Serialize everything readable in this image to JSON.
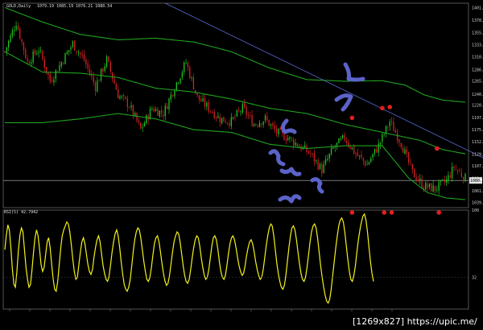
{
  "chart_data": [
    {
      "type": "candlestick",
      "symbol_label": "GOLD,Daily",
      "ohlc_label": "1079.19 1085.19 1076.21 1080.54",
      "yticks": [
        "1401.6",
        "1378.8",
        "1355.3",
        "1333.3",
        "1310.5",
        "1286.5",
        "1265.9",
        "1240.8",
        "1220.7",
        "1197.8",
        "1175.4",
        "1152.5",
        "1129.5",
        "1107.6",
        "1084.6",
        "1061.6",
        "1039.5"
      ],
      "ylim": [
        1030,
        1410
      ],
      "current_price": "1080.54",
      "bull_color": "#23c423",
      "bear_color": "#d42323",
      "bands_color": "#1fa31f",
      "trendline_color": "#5a6ad6",
      "marker_color": "#e01f1f",
      "series": [
        {
          "name": "price",
          "anchors": [
            [
              0,
              1320
            ],
            [
              6,
              1375
            ],
            [
              12,
              1300
            ],
            [
              18,
              1325
            ],
            [
              24,
              1265
            ],
            [
              30,
              1300
            ],
            [
              36,
              1335
            ],
            [
              42,
              1305
            ],
            [
              48,
              1255
            ],
            [
              54,
              1305
            ],
            [
              60,
              1240
            ],
            [
              66,
              1220
            ],
            [
              72,
              1175
            ],
            [
              78,
              1215
            ],
            [
              84,
              1205
            ],
            [
              90,
              1255
            ],
            [
              96,
              1300
            ],
            [
              102,
              1235
            ],
            [
              108,
              1215
            ],
            [
              114,
              1195
            ],
            [
              120,
              1190
            ],
            [
              126,
              1215
            ],
            [
              132,
              1185
            ],
            [
              138,
              1195
            ],
            [
              144,
              1170
            ],
            [
              150,
              1160
            ],
            [
              156,
              1145
            ],
            [
              162,
              1130
            ],
            [
              168,
              1100
            ],
            [
              174,
              1140
            ],
            [
              180,
              1160
            ],
            [
              186,
              1130
            ],
            [
              192,
              1110
            ],
            [
              198,
              1145
            ],
            [
              204,
              1190
            ],
            [
              210,
              1150
            ],
            [
              216,
              1095
            ],
            [
              222,
              1070
            ],
            [
              228,
              1065
            ],
            [
              234,
              1080
            ],
            [
              238,
              1105
            ],
            [
              244,
              1085
            ]
          ]
        },
        {
          "name": "upper_band",
          "anchors": [
            [
              0,
              1402
            ],
            [
              20,
              1375
            ],
            [
              40,
              1352
            ],
            [
              60,
              1342
            ],
            [
              80,
              1345
            ],
            [
              100,
              1338
            ],
            [
              120,
              1320
            ],
            [
              140,
              1290
            ],
            [
              160,
              1268
            ],
            [
              180,
              1265
            ],
            [
              200,
              1266
            ],
            [
              212,
              1258
            ],
            [
              222,
              1240
            ],
            [
              232,
              1230
            ],
            [
              244,
              1226
            ]
          ]
        },
        {
          "name": "middle_band",
          "anchors": [
            [
              0,
              1320
            ],
            [
              20,
              1282
            ],
            [
              40,
              1280
            ],
            [
              60,
              1272
            ],
            [
              80,
              1252
            ],
            [
              100,
              1245
            ],
            [
              120,
              1232
            ],
            [
              140,
              1215
            ],
            [
              160,
              1205
            ],
            [
              180,
              1185
            ],
            [
              200,
              1170
            ],
            [
              220,
              1155
            ],
            [
              232,
              1138
            ],
            [
              244,
              1130
            ]
          ]
        },
        {
          "name": "lower_band",
          "anchors": [
            [
              0,
              1188
            ],
            [
              20,
              1188
            ],
            [
              40,
              1195
            ],
            [
              60,
              1205
            ],
            [
              80,
              1195
            ],
            [
              100,
              1175
            ],
            [
              120,
              1170
            ],
            [
              140,
              1148
            ],
            [
              160,
              1140
            ],
            [
              180,
              1145
            ],
            [
              200,
              1145
            ],
            [
              214,
              1085
            ],
            [
              224,
              1058
            ],
            [
              234,
              1048
            ],
            [
              244,
              1045
            ]
          ]
        }
      ],
      "trendlines": [
        [
          [
            85,
            1410
          ],
          [
            302,
            1040
          ]
        ]
      ],
      "markers": [
        [
          200,
          1215
        ],
        [
          204,
          1217
        ],
        [
          184,
          1197
        ],
        [
          229,
          1140
        ],
        [
          184,
          1045
        ],
        [
          201,
          1042
        ],
        [
          205,
          1042
        ],
        [
          230,
          1040
        ]
      ],
      "bar_count": 245
    },
    {
      "type": "line",
      "label": "RSI(5) 42.7942",
      "color": "#f2f21a",
      "ylim": [
        0,
        100
      ],
      "yticks": [
        "100",
        "32"
      ],
      "values": [
        60,
        75,
        85,
        80,
        62,
        40,
        25,
        22,
        38,
        60,
        75,
        82,
        78,
        60,
        42,
        30,
        22,
        25,
        40,
        58,
        72,
        80,
        74,
        60,
        45,
        38,
        42,
        55,
        68,
        72,
        62,
        45,
        30,
        20,
        18,
        28,
        45,
        62,
        74,
        80,
        84,
        88,
        86,
        78,
        65,
        50,
        38,
        30,
        32,
        45,
        58,
        68,
        72,
        66,
        55,
        45,
        38,
        35,
        40,
        52,
        62,
        70,
        74,
        68,
        56,
        44,
        36,
        30,
        28,
        33,
        45,
        58,
        68,
        76,
        80,
        74,
        62,
        48,
        35,
        25,
        20,
        18,
        22,
        30,
        44,
        58,
        70,
        78,
        82,
        80,
        72,
        60,
        48,
        38,
        30,
        28,
        32,
        42,
        55,
        66,
        72,
        74,
        68,
        58,
        46,
        36,
        28,
        24,
        26,
        34,
        46,
        58,
        68,
        74,
        78,
        76,
        68,
        56,
        44,
        34,
        28,
        26,
        30,
        40,
        52,
        62,
        70,
        74,
        72,
        64,
        52,
        42,
        34,
        30,
        32,
        40,
        52,
        64,
        72,
        74,
        70,
        60,
        48,
        38,
        32,
        30,
        34,
        44,
        56,
        66,
        72,
        74,
        70,
        62,
        52,
        44,
        38,
        34,
        36,
        44,
        54,
        62,
        68,
        70,
        66,
        58,
        48,
        40,
        34,
        30,
        32,
        40,
        52,
        64,
        74,
        82,
        86,
        84,
        74,
        60,
        46,
        36,
        28,
        22,
        20,
        24,
        34,
        48,
        62,
        74,
        82,
        84,
        80,
        70,
        58,
        46,
        36,
        30,
        28,
        32,
        42,
        55,
        68,
        78,
        84,
        86,
        82,
        72,
        58,
        44,
        32,
        22,
        14,
        8,
        6,
        10,
        20,
        34,
        48,
        62,
        74,
        84,
        90,
        92,
        88,
        78,
        64,
        50,
        38,
        30,
        28,
        34,
        44,
        58,
        70,
        80,
        88,
        94,
        96,
        90,
        78,
        62,
        48,
        36,
        28
      ]
    }
  ],
  "footer": {
    "watermark": "[1269x827] https://upic.me/"
  }
}
